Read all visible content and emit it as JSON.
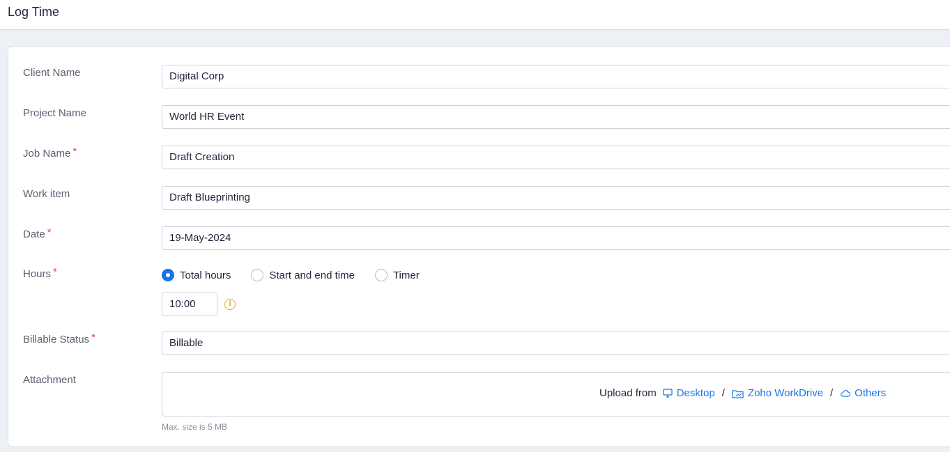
{
  "header": {
    "title": "Log Time"
  },
  "form": {
    "client": {
      "label": "Client Name",
      "value": "Digital Corp"
    },
    "project": {
      "label": "Project Name",
      "value": "World HR Event"
    },
    "job": {
      "label": "Job Name",
      "required": "*",
      "value": "Draft Creation"
    },
    "work_item": {
      "label": "Work item",
      "value": "Draft Blueprinting"
    },
    "date": {
      "label": "Date",
      "required": "*",
      "value": "19-May-2024"
    },
    "hours": {
      "label": "Hours",
      "required": "*",
      "options": [
        "Total hours",
        "Start and end time",
        "Timer"
      ],
      "selected": "Total hours",
      "value": "10:00",
      "info_icon": "info-icon"
    },
    "billable": {
      "label": "Billable Status",
      "required": "*",
      "value": "Billable"
    },
    "attachment": {
      "label": "Attachment",
      "upload_from": "Upload from",
      "sources": [
        "Desktop",
        "Zoho WorkDrive",
        "Others"
      ],
      "separator": "/",
      "hint": "Max. size is 5 MB"
    }
  },
  "colors": {
    "accent": "#1a73e8",
    "required": "#e24a4a",
    "info": "#e8a138"
  }
}
